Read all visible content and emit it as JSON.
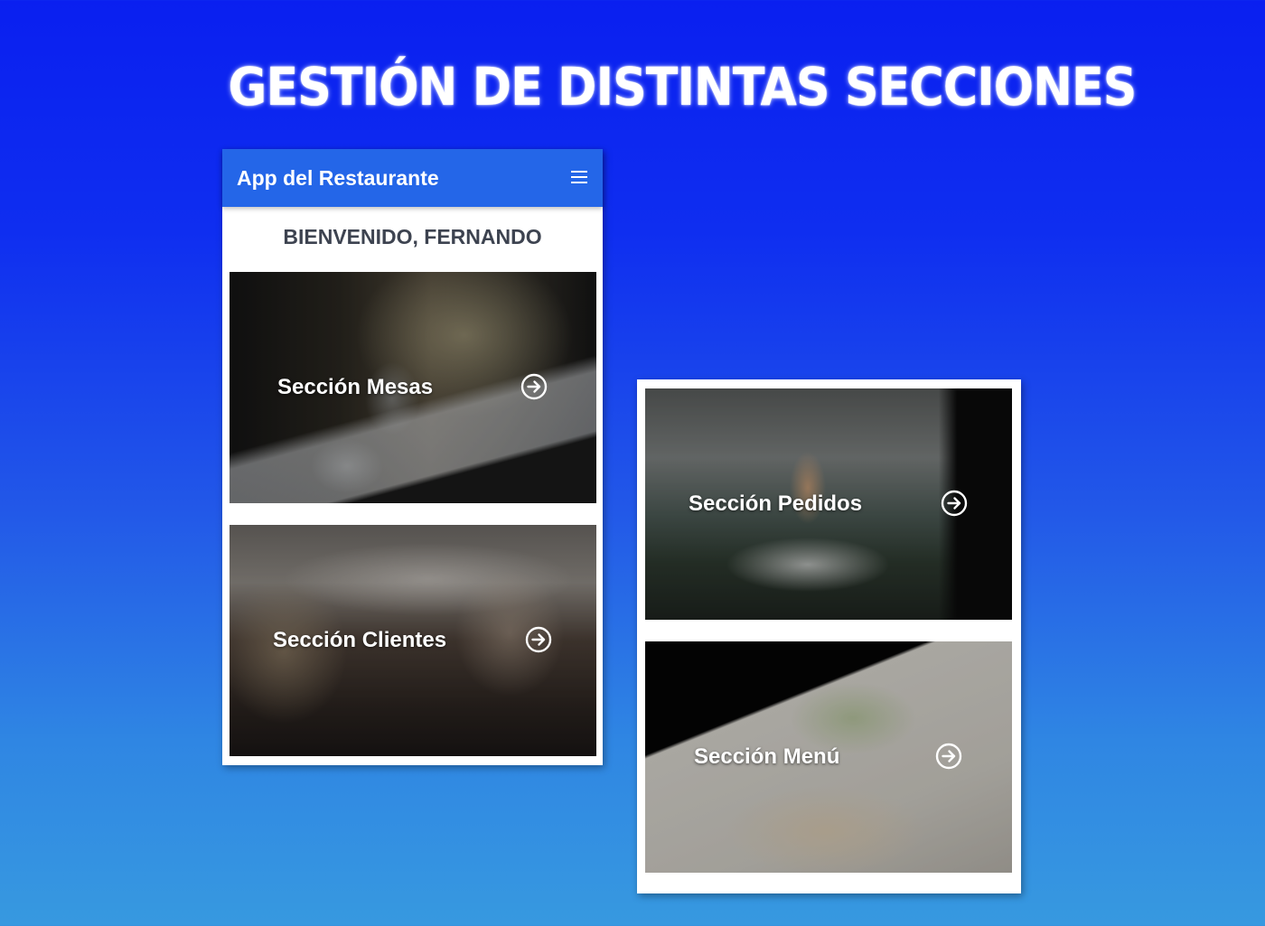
{
  "page": {
    "title": "GESTIÓN DE DISTINTAS SECCIONES"
  },
  "app": {
    "header_title": "App del Restaurante",
    "menu_icon": "hamburger-menu-icon",
    "welcome": "BIENVENIDO, FERNANDO",
    "accent_color": "#2466e8"
  },
  "sections": [
    {
      "label": "Sección Mesas",
      "icon": "arrow-right-circle-icon"
    },
    {
      "label": "Sección Clientes",
      "icon": "arrow-right-circle-icon"
    },
    {
      "label": "Sección Pedidos",
      "icon": "arrow-right-circle-icon"
    },
    {
      "label": "Sección Menú",
      "icon": "arrow-right-circle-icon"
    }
  ]
}
